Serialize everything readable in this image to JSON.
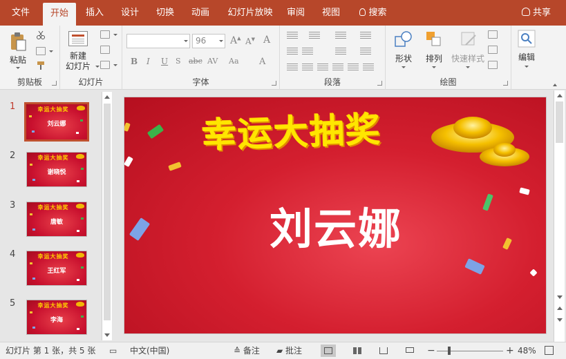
{
  "tabs": [
    "文件",
    "开始",
    "插入",
    "设计",
    "切换",
    "动画",
    "幻灯片放映",
    "审阅",
    "视图"
  ],
  "search_label": "搜索",
  "share_label": "共享",
  "ribbon": {
    "paste_label": "粘贴",
    "clipboard_group": "剪贴板",
    "new_slide_line1": "新建",
    "new_slide_line2": "幻灯片",
    "slides_group": "幻灯片",
    "font_size": "96",
    "font_group": "字体",
    "paragraph_group": "段落",
    "shapes_label": "形状",
    "arrange_label": "排列",
    "quick_styles_label": "快速样式",
    "drawing_group": "绘图",
    "edit_label": "编辑"
  },
  "thumbnails": [
    {
      "number": "1",
      "title": "幸运大抽奖",
      "name": "刘云娜",
      "active": true
    },
    {
      "number": "2",
      "title": "幸运大抽奖",
      "name": "谢晓悦",
      "active": false
    },
    {
      "number": "3",
      "title": "幸运大抽奖",
      "name": "唐敏",
      "active": false
    },
    {
      "number": "4",
      "title": "幸运大抽奖",
      "name": "王红军",
      "active": false
    },
    {
      "number": "5",
      "title": "幸运大抽奖",
      "name": "李海",
      "active": false
    }
  ],
  "slide": {
    "title": "幸运大抽奖",
    "name": "刘云娜"
  },
  "status": {
    "slide_info": "幻灯片 第 1 张，共 5 张",
    "language": "中文(中国)",
    "notes_label": "备注",
    "comments_label": "批注",
    "zoom": "48%"
  },
  "colors": {
    "accent": "#b7472a",
    "slide_red": "#d41f2f",
    "title_yellow": "#ffe600"
  }
}
